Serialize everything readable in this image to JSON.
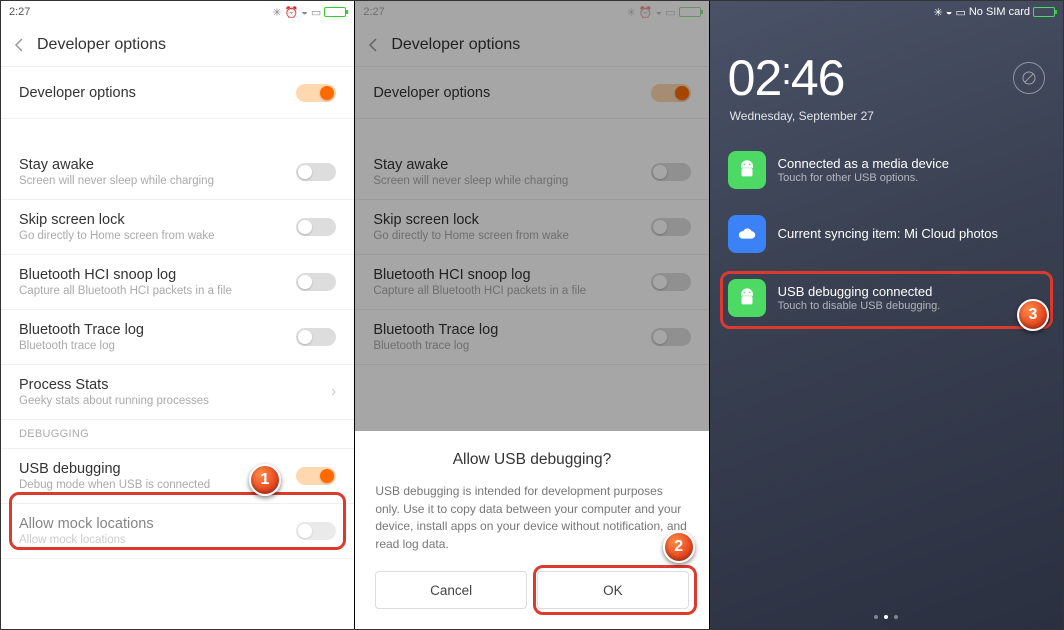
{
  "status": {
    "time12": "2:27",
    "noSim": "No SIM card"
  },
  "header": {
    "title": "Developer options"
  },
  "settings": {
    "devOptions": {
      "label": "Developer options"
    },
    "stayAwake": {
      "label": "Stay awake",
      "sub": "Screen will never sleep while charging"
    },
    "skipLock": {
      "label": "Skip screen lock",
      "sub": "Go directly to Home screen from wake"
    },
    "btSnoop": {
      "label": "Bluetooth HCI snoop log",
      "sub": "Capture all Bluetooth HCI packets in a file"
    },
    "btTrace": {
      "label": "Bluetooth Trace log",
      "sub": "Bluetooth trace log"
    },
    "procStats": {
      "label": "Process Stats",
      "sub": "Geeky stats about running processes"
    },
    "sectionDebug": "DEBUGGING",
    "usbDebug": {
      "label": "USB debugging",
      "sub": "Debug mode when USB is connected"
    },
    "mock": {
      "label": "Allow mock locations",
      "sub": "Allow mock locations"
    }
  },
  "dialog": {
    "title": "Allow USB debugging?",
    "body": "USB debugging is intended for development purposes only. Use it to copy data between your computer and your device, install apps on your device without notification, and read log data.",
    "cancel": "Cancel",
    "ok": "OK"
  },
  "lock": {
    "hours": "02",
    "mins": "46",
    "date": "Wednesday, September 27",
    "notif1": {
      "label": "Connected as a media device",
      "sub": "Touch for other USB options."
    },
    "notif2": {
      "label": "Current syncing item: Mi Cloud photos",
      "sub": ""
    },
    "notif3": {
      "label": "USB debugging connected",
      "sub": "Touch to disable USB debugging."
    }
  },
  "annotations": {
    "b1": "1",
    "b2": "2",
    "b3": "3"
  }
}
